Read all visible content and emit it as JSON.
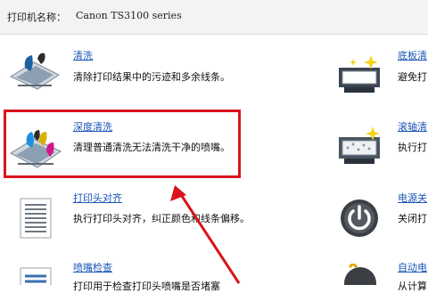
{
  "header": {
    "label": "打印机名称：",
    "printer_name": "Canon TS3100 series"
  },
  "left_items": [
    {
      "title": "清洗",
      "desc": "清除打印结果中的污迹和多余线条。"
    },
    {
      "title": "深度清洗",
      "desc": "清理普通清洗无法清洗干净的喷嘴。"
    },
    {
      "title": "打印头对齐",
      "desc": "执行打印头对齐，纠正颜色和线条偏移。"
    },
    {
      "title": "喷嘴检查",
      "desc": "打印用于检查打印头喷嘴是否堵塞"
    }
  ],
  "right_items": [
    {
      "title": "底板清",
      "desc": "避免打"
    },
    {
      "title": "滚轴清",
      "desc": "执行打"
    },
    {
      "title": "电源关",
      "desc": "关闭打"
    },
    {
      "title": "自动电",
      "desc": "从计算"
    }
  ]
}
